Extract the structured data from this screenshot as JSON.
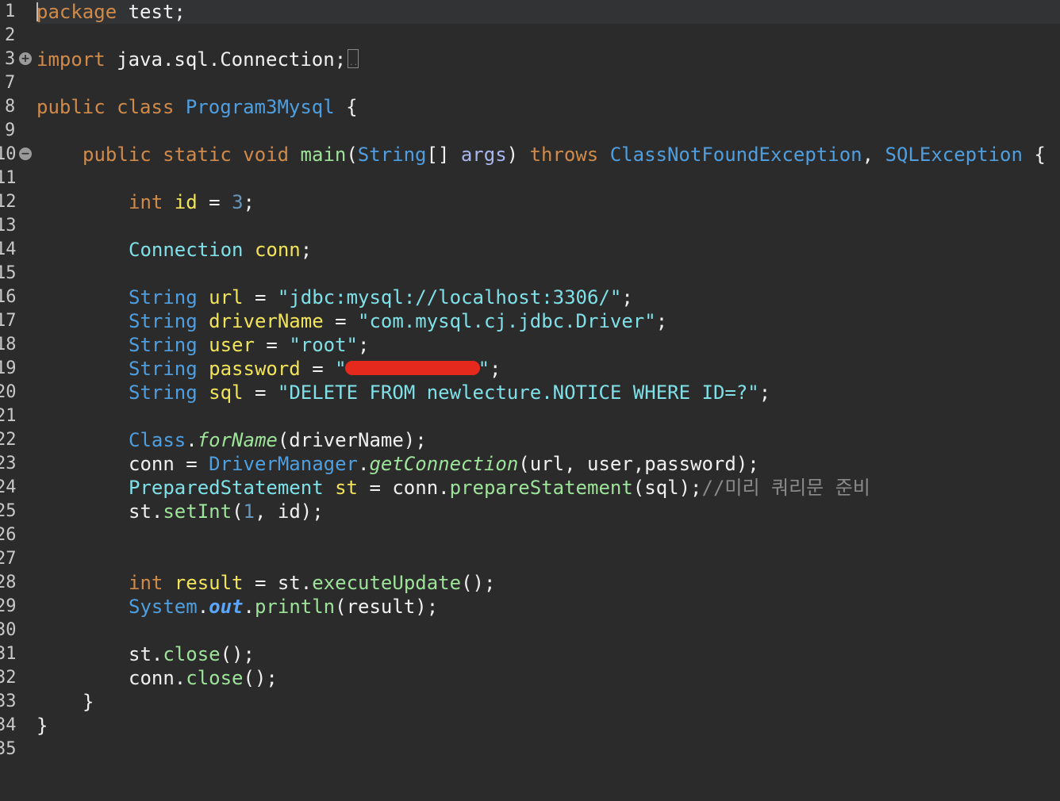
{
  "editor": {
    "title": "",
    "line_numbers": [
      "1",
      "2",
      "3",
      "7",
      "8",
      "9",
      "10",
      "11",
      "12",
      "13",
      "14",
      "15",
      "16",
      "17",
      "18",
      "19",
      "20",
      "21",
      "22",
      "23",
      "24",
      "25",
      "26",
      "27",
      "28",
      "29",
      "30",
      "31",
      "32",
      "33",
      "34",
      "35"
    ],
    "tokens": {
      "l1_kw": "package",
      "l1_rest": " test;",
      "l3_kw": "import",
      "l3_rest": " java.sql.Connection;",
      "l8_kw": "public class ",
      "l8_cls": "Program3Mysql",
      "l8_rest": " {",
      "l10_kw": "public static void ",
      "l10_fn": "main",
      "l10_p1": "(",
      "l10_t1": "String",
      "l10_p2": "[] ",
      "l10_arg": "args",
      "l10_p3": ") ",
      "l10_kw2": "throws ",
      "l10_t2": "ClassNotFoundException",
      "l10_p4": ", ",
      "l10_t3": "SQLException",
      "l10_p5": " {",
      "l12_kw": "int ",
      "l12_var": "id",
      "l12_p": " = ",
      "l12_num": "3",
      "l12_end": ";",
      "l14_cls": "Connection ",
      "l14_var": "conn",
      "l14_end": ";",
      "l16_ty": "String ",
      "l16_var": "url",
      "l16_p": " = ",
      "l16_str": "\"jdbc:mysql://localhost:3306/\"",
      "l16_end": ";",
      "l17_ty": "String ",
      "l17_var": "driverName",
      "l17_p": " = ",
      "l17_str": "\"com.mysql.cj.jdbc.Driver\"",
      "l17_end": ";",
      "l18_ty": "String ",
      "l18_var": "user",
      "l18_p": " = ",
      "l18_str": "\"root\"",
      "l18_end": ";",
      "l19_ty": "String ",
      "l19_var": "password",
      "l19_p": " = ",
      "l19_q1": "\"",
      "l19_q2": "\"",
      "l19_end": ";",
      "l20_ty": "String ",
      "l20_var": "sql",
      "l20_p": " = ",
      "l20_str": "\"DELETE FROM newlecture.NOTICE WHERE ID=?\"",
      "l20_end": ";",
      "l22_ty": "Class",
      "l22_dot": ".",
      "l22_fn": "forName",
      "l22_rest": "(driverName);",
      "l23_var": "conn",
      "l23_p": " = ",
      "l23_ty": "DriverManager",
      "l23_dot": ".",
      "l23_fn": "getConnection",
      "l23_rest": "(url, user,password);",
      "l24_cls": "PreparedStatement ",
      "l24_var": "st",
      "l24_p": " = ",
      "l24_obj": "conn",
      "l24_dot": ".",
      "l24_fn": "prepareStatement",
      "l24_rest": "(sql);",
      "l24_cm": "//미리 쿼리문 준비",
      "l25_obj": "st",
      "l25_dot": ".",
      "l25_fn": "setInt",
      "l25_p1": "(",
      "l25_num": "1",
      "l25_rest": ", id);",
      "l28_kw": "int ",
      "l28_var": "result",
      "l28_p": " = ",
      "l28_obj": "st",
      "l28_dot": ".",
      "l28_fn": "executeUpdate",
      "l28_rest": "();",
      "l29_ty": "System",
      "l29_dot": ".",
      "l29_fld": "out",
      "l29_dot2": ".",
      "l29_fn": "println",
      "l29_rest": "(result);",
      "l31_obj": "st",
      "l31_dot": ".",
      "l31_fn": "close",
      "l31_rest": "();",
      "l32_obj": "conn",
      "l32_dot": ".",
      "l32_fn": "close",
      "l32_rest": "();",
      "l33": "}",
      "l34": "}"
    }
  },
  "colors": {
    "background": "#2b2b2b",
    "keyword": "#d08a4a",
    "type": "#4f9fe0",
    "string": "#7fe0e8",
    "variable": "#f2e45a",
    "method": "#9ee39a",
    "redaction": "#e5291d"
  },
  "icons": [
    "fold-expand-icon",
    "fold-collapse-icon",
    "folded-code-icon"
  ]
}
